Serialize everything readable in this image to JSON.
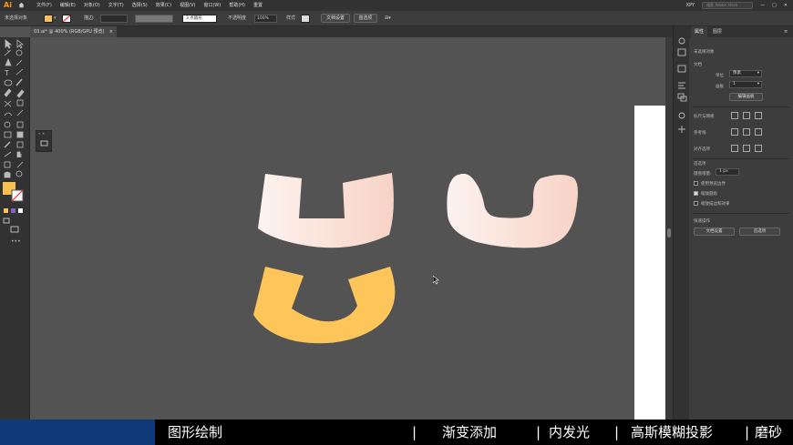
{
  "menubar": {
    "logo": "Ai",
    "menus": [
      "文件(F)",
      "编辑(E)",
      "对象(O)",
      "文字(T)",
      "选择(S)",
      "效果(C)",
      "视图(V)",
      "窗口(W)",
      "帮助(H)",
      "重置"
    ],
    "workspace": "XPY",
    "search_placeholder": "搜索 Adobe Stock"
  },
  "controlbar": {
    "selection": "未选择对象",
    "stroke_label": "描边:",
    "brush": "3 点圆形",
    "opacity_label": "不透明度",
    "opacity_value": "100%",
    "style_label": "样式",
    "doc_setup": "文档设置",
    "preferences": "首选项"
  },
  "document_tab": {
    "title": "03.ai* @ 400% (RGB/GPU 预览)",
    "close": "×"
  },
  "colors": {
    "fill": "#f9c052",
    "gradient_start": "#fdf3ef",
    "gradient_end": "#f8d3c6",
    "yellow_shape": "#fdc55a",
    "canvas": "#535353",
    "accent_blue": "#0e3a7a"
  },
  "properties_panel": {
    "tabs": [
      "属性",
      "图层"
    ],
    "no_selection": "未选择对象",
    "document_heading": "文档",
    "units_label": "单位",
    "units_value": "像素",
    "artboard_label": "画板",
    "artboard_value": "1",
    "edit_artboard": "编辑画板",
    "rulers_grid": "标尺与网格",
    "guides": "参考线",
    "align_to": "对齐选项",
    "prefs_heading": "首选项",
    "keyboard_increment_label": "键盘增量:",
    "keyboard_increment_value": "1 px",
    "cb_preview_bounds": "使用预览边界",
    "cb_scale_corners": "缩放圆角",
    "cb_scale_strokes": "缩放描边和效果",
    "quick_actions": "快速操作",
    "doc_setup_btn": "文档设置",
    "prefs_btn": "首选项"
  },
  "subtitle_bar": {
    "items": [
      "图形绘制",
      "渐变添加",
      "内发光",
      "高斯模糊投影",
      "磨砂"
    ],
    "separator": "|"
  }
}
